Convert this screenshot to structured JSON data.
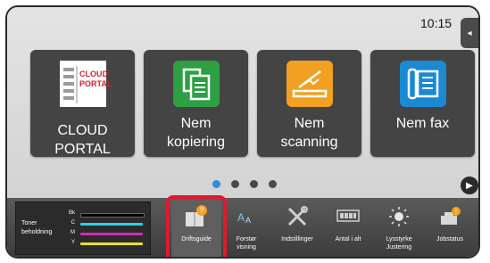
{
  "status": {
    "time": "10:15"
  },
  "tiles": [
    {
      "label": "CLOUD PORTAL",
      "logo_line1": "CLOUD",
      "logo_line2": "PORTAL",
      "icon": "cloud-portal-icon"
    },
    {
      "label": "Nem kopiering",
      "icon": "copy-icon",
      "icon_color": "#2ea043"
    },
    {
      "label": "Nem scanning",
      "icon": "scan-icon",
      "icon_color": "#f0a122"
    },
    {
      "label": "Nem fax",
      "icon": "fax-icon",
      "icon_color": "#1a8ad3"
    }
  ],
  "pager": {
    "pages": 4,
    "current": 1
  },
  "toner": {
    "title_line1": "Toner",
    "title_line2": "beholdning",
    "levels": [
      {
        "label": "Bk",
        "color": "#000000",
        "fraction": 1.0
      },
      {
        "label": "C",
        "color": "#2ad0e8",
        "fraction": 1.0
      },
      {
        "label": "M",
        "color": "#d12ab6",
        "fraction": 1.0
      },
      {
        "label": "Y",
        "color": "#e8e02a",
        "fraction": 1.0
      }
    ]
  },
  "bottom_buttons": [
    {
      "label": "Driftsguide",
      "icon": "operation-guide-icon",
      "selected": true
    },
    {
      "label_line1": "Forstør",
      "label_line2": "visning",
      "icon": "enlarge-display-icon"
    },
    {
      "label": "Indstillinger",
      "icon": "settings-tools-icon"
    },
    {
      "label": "Antal i alt",
      "icon": "total-count-icon"
    },
    {
      "label_line1": "Lysstyrke",
      "label_line2": "Justering",
      "icon": "brightness-icon"
    },
    {
      "label": "Jobstatus",
      "icon": "job-status-icon"
    }
  ],
  "colors": {
    "highlight": "#e3182d",
    "accent": "#2b90d9"
  }
}
